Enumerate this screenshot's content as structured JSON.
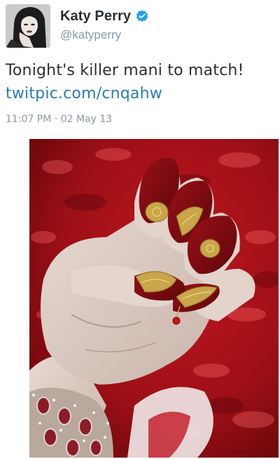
{
  "tweet": {
    "display_name": "Katy Perry",
    "handle": "@katyperry",
    "verified": true,
    "text": "Tonight's killer mani to match!",
    "link": "twitpic.com/cnqahw",
    "time": "11:07 PM",
    "separator": "·",
    "date": "02 May 13"
  },
  "icons": {
    "verified": "verified-badge-icon"
  },
  "colors": {
    "name": "#292f33",
    "handle": "#8899a6",
    "link": "#2b7bb9",
    "verified_badge": "#1da1f2"
  }
}
